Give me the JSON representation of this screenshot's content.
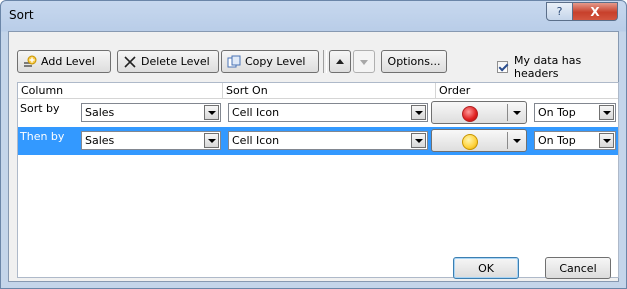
{
  "window": {
    "title": "Sort",
    "help_label": "?",
    "close_label": "X"
  },
  "toolbar": {
    "add_level_label": "Add Level",
    "delete_level_label": "Delete Level",
    "copy_level_label": "Copy Level",
    "options_label": "Options...",
    "headers_checkbox_label": "My data has headers",
    "headers_checked": true
  },
  "grid": {
    "headers": {
      "column": "Column",
      "sort_on": "Sort On",
      "order": "Order"
    },
    "rows": [
      {
        "label": "Sort by",
        "column": "Sales",
        "sort_on": "Cell Icon",
        "icon_color": "#e02020",
        "icon_name": "red-circle-icon",
        "position": "On Top"
      },
      {
        "label": "Then by",
        "column": "Sales",
        "sort_on": "Cell Icon",
        "icon_color": "#ffd23c",
        "icon_name": "yellow-circle-icon",
        "position": "On Top"
      }
    ]
  },
  "buttons": {
    "ok_label": "OK",
    "cancel_label": "Cancel"
  },
  "colors": {
    "selection": "#3399ff",
    "title_bar": "#c7d8ee",
    "close_button": "#c7402b"
  }
}
